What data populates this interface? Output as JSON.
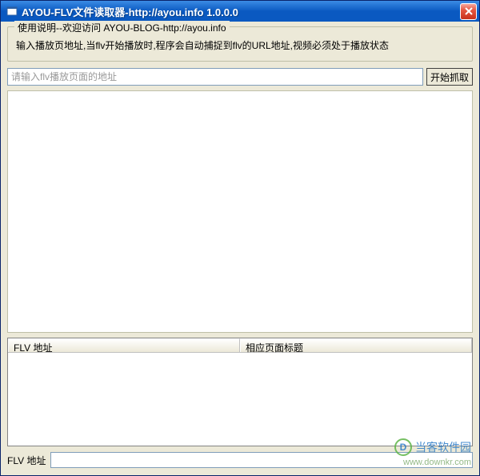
{
  "window": {
    "title": "AYOU-FLV文件读取器-http://ayou.info 1.0.0.0"
  },
  "groupbox": {
    "title": "使用说明--欢迎访问 AYOU-BLOG-http://ayou.info",
    "instruction": "输入播放页地址,当flv开始播放时,程序会自动捕捉到flv的URL地址,视频必须处于播放状态"
  },
  "input": {
    "placeholder": "请输入flv播放页面的地址",
    "value": ""
  },
  "buttons": {
    "capture": "开始抓取"
  },
  "listview": {
    "col1": "FLV 地址",
    "col2": "相应页面标题"
  },
  "bottom": {
    "label": "FLV 地址",
    "value": ""
  },
  "watermark": {
    "brand": "当客软件园",
    "url": "www.downkr.com"
  }
}
